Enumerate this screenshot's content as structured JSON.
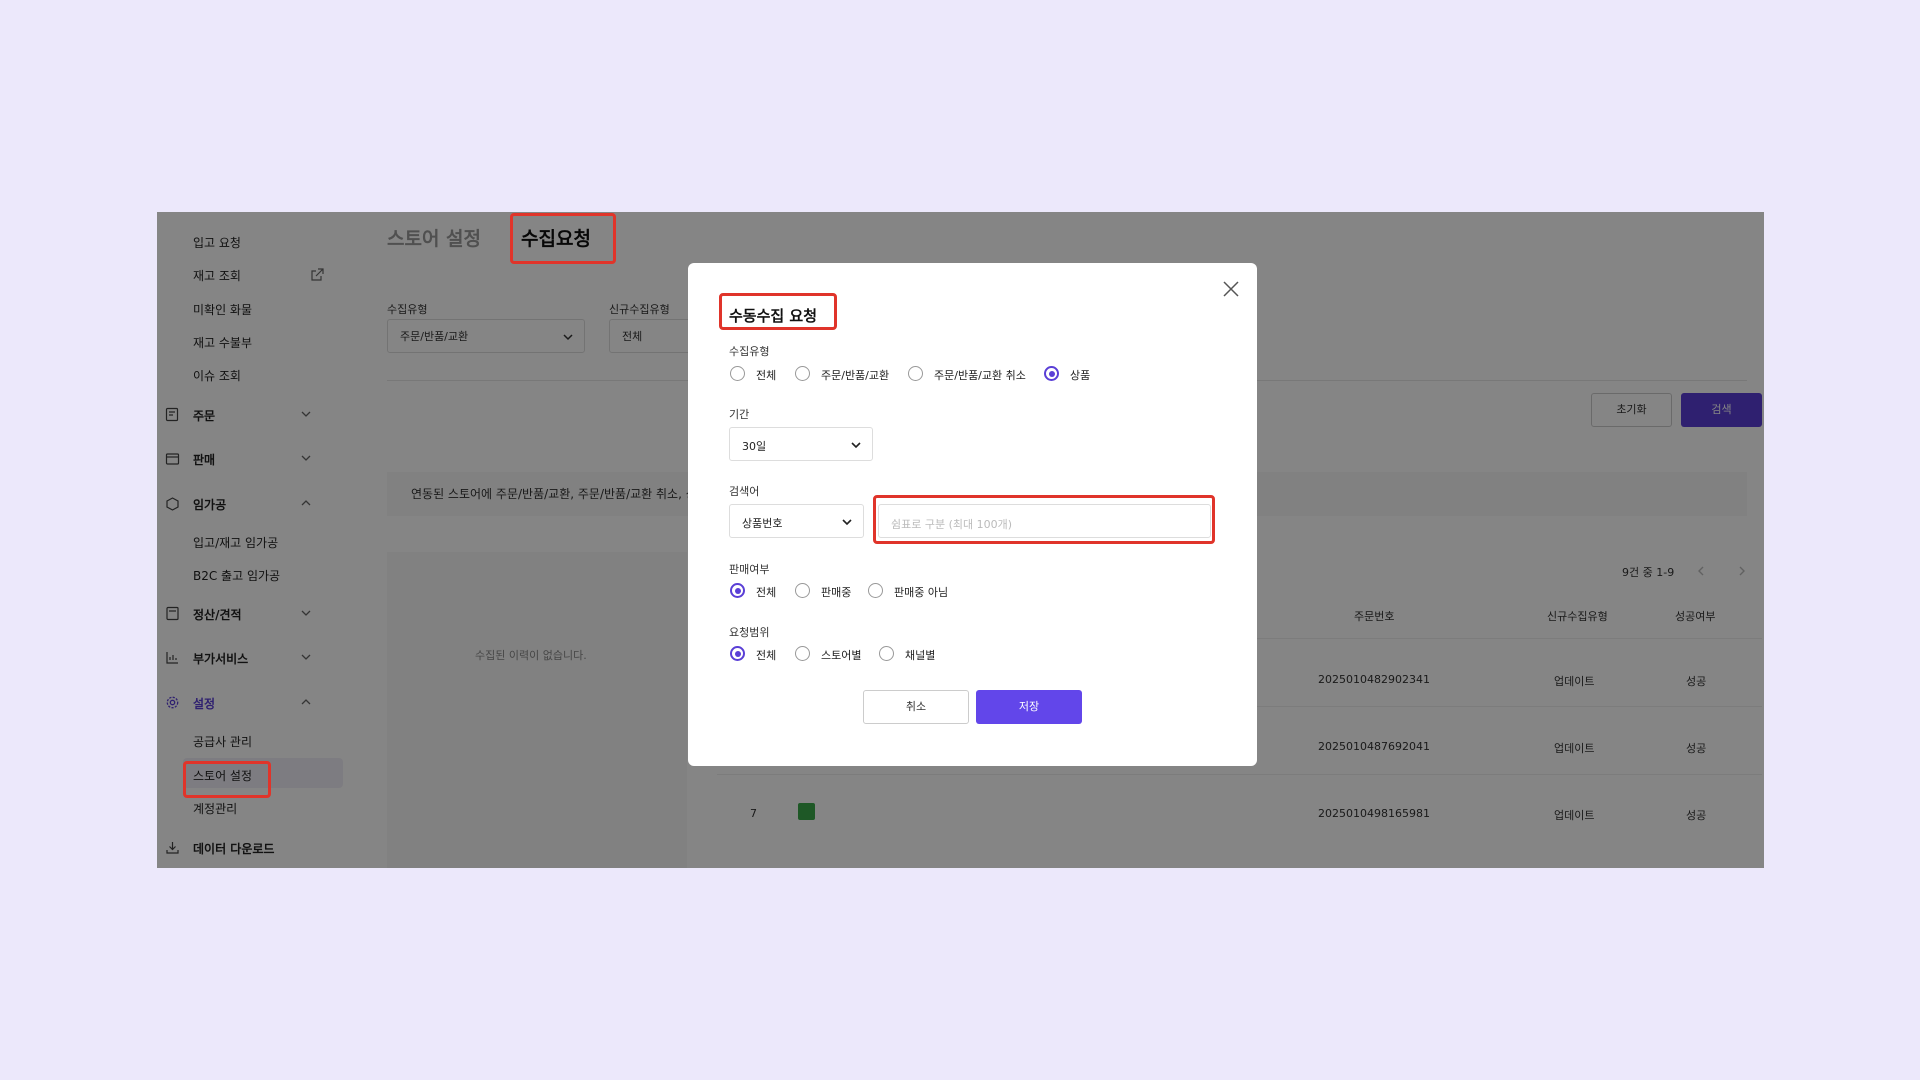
{
  "sidebar": {
    "sub_items_top": [
      "입고 요청",
      "재고 조회",
      "미확인 화물",
      "재고 수불부",
      "이슈 조회"
    ],
    "sections": [
      {
        "label": "주문"
      },
      {
        "label": "판매"
      },
      {
        "label": "임가공",
        "children": [
          "입고/재고 임가공",
          "B2C 출고 임가공"
        ]
      },
      {
        "label": "정산/견적"
      },
      {
        "label": "부가서비스"
      },
      {
        "label": "설정",
        "children": [
          "공급사 관리",
          "스토어 설정",
          "계정관리"
        ]
      },
      {
        "label": "데이터 다운로드"
      }
    ]
  },
  "header": {
    "breadcrumb": "스토어 설정",
    "title": "수집요청"
  },
  "filters": {
    "type_label": "수집유형",
    "type_value": "주문/반품/교환",
    "new_type_label": "신규수집유형",
    "new_type_value": "전체",
    "reset_label": "초기화",
    "search_label": "검색"
  },
  "notice": "연동된 스토어에 주문/반품/교환, 주문/반품/교환 취소, 상",
  "empty_text": "수집된 이력이 없습니다.",
  "pagination": "9건 중 1-9",
  "table": {
    "headers": [
      "주문번호",
      "신규수집유형",
      "성공여부"
    ],
    "rows": [
      {
        "no": "",
        "order": "2025010482902341",
        "type": "업데이트",
        "result": "성공"
      },
      {
        "no": "",
        "order": "2025010487692041",
        "type": "업데이트",
        "result": "성공"
      },
      {
        "no": "7",
        "order": "2025010498165981",
        "type": "업데이트",
        "result": "성공"
      }
    ]
  },
  "modal": {
    "title": "수동수집 요청",
    "collect_type_label": "수집유형",
    "collect_type_options": [
      "전체",
      "주문/반품/교환",
      "주문/반품/교환 취소",
      "상품"
    ],
    "collect_type_selected": "상품",
    "period_label": "기간",
    "period_value": "30일",
    "keyword_label": "검색어",
    "keyword_type": "상품번호",
    "keyword_placeholder": "쉼표로 구분 (최대 100개)",
    "sale_label": "판매여부",
    "sale_options": [
      "전체",
      "판매중",
      "판매중 아님"
    ],
    "sale_selected": "전체",
    "scope_label": "요청범위",
    "scope_options": [
      "전체",
      "스토어별",
      "채널별"
    ],
    "scope_selected": "전체",
    "cancel_label": "취소",
    "save_label": "저장"
  },
  "colors": {
    "accent": "#5a3fd6",
    "highlight": "#e0342a",
    "page_bg": "#ece8fb"
  }
}
